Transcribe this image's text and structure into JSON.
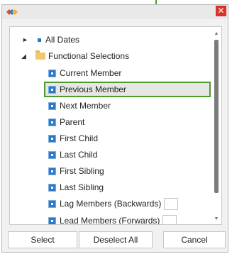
{
  "title_bar": {
    "logo_icon": "app-logo-icon",
    "close_glyph": "✕"
  },
  "tree": {
    "items": [
      {
        "label": "All Dates",
        "icon": "dimension-icon",
        "expander": "►"
      },
      {
        "label": "Functional Selections",
        "icon": "folder-icon",
        "expander": "◢"
      },
      {
        "label": "Current Member",
        "icon": "member-function-icon"
      },
      {
        "label": "Previous Member",
        "icon": "member-function-icon"
      },
      {
        "label": "Next Member",
        "icon": "member-function-icon"
      },
      {
        "label": "Parent",
        "icon": "member-function-icon"
      },
      {
        "label": "First Child",
        "icon": "member-function-icon"
      },
      {
        "label": "Last Child",
        "icon": "member-function-icon"
      },
      {
        "label": "First Sibling",
        "icon": "member-function-icon"
      },
      {
        "label": "Last Sibling",
        "icon": "member-function-icon"
      },
      {
        "label": "Lag Members (Backwards)",
        "icon": "member-function-icon",
        "number_value": ""
      },
      {
        "label": "Lead Members (Forwards)",
        "icon": "member-function-icon",
        "number_value": ""
      }
    ],
    "selected": "Previous Member"
  },
  "scrollbar": {
    "up": "▲",
    "down": "▼"
  },
  "buttons": {
    "select": "Select",
    "deselect_all": "Deselect All",
    "cancel": "Cancel"
  },
  "colors": {
    "highlight_border": "#4f9a2f",
    "close_bg": "#d9342a",
    "icon_blue": "#2b79c7"
  }
}
